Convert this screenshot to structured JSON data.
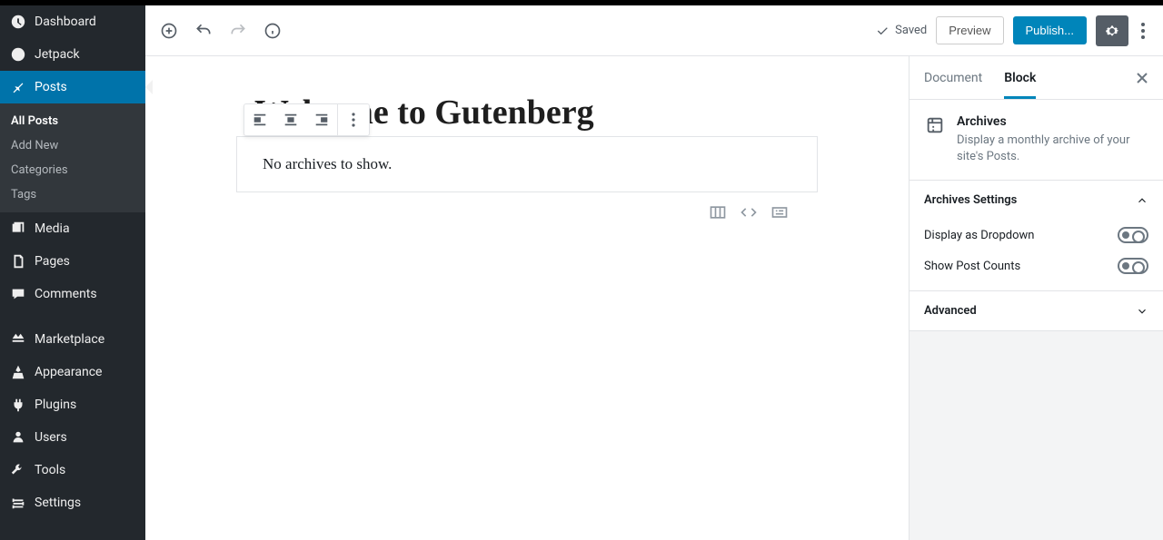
{
  "sidebar": {
    "items": [
      {
        "label": "Dashboard"
      },
      {
        "label": "Jetpack"
      },
      {
        "label": "Posts"
      },
      {
        "label": "Media"
      },
      {
        "label": "Pages"
      },
      {
        "label": "Comments"
      },
      {
        "label": "Marketplace"
      },
      {
        "label": "Appearance"
      },
      {
        "label": "Plugins"
      },
      {
        "label": "Users"
      },
      {
        "label": "Tools"
      },
      {
        "label": "Settings"
      }
    ],
    "posts_sub": [
      {
        "label": "All Posts"
      },
      {
        "label": "Add New"
      },
      {
        "label": "Categories"
      },
      {
        "label": "Tags"
      }
    ]
  },
  "topbar": {
    "saved": "Saved",
    "preview": "Preview",
    "publish": "Publish..."
  },
  "post": {
    "title": "Welcome to Gutenberg",
    "block_text": "No archives to show."
  },
  "inspector": {
    "tabs": {
      "document": "Document",
      "block": "Block"
    },
    "block": {
      "title": "Archives",
      "description": "Display a monthly archive of your site's Posts."
    },
    "panels": {
      "settings_title": "Archives Settings",
      "dropdown_label": "Display as Dropdown",
      "counts_label": "Show Post Counts",
      "advanced_title": "Advanced"
    }
  }
}
